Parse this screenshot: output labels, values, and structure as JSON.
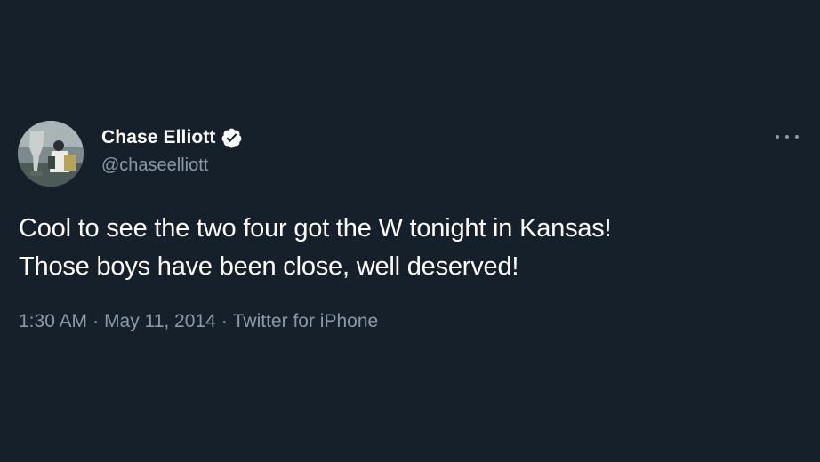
{
  "author": {
    "display_name": "Chase Elliott",
    "handle": "@chaseelliott",
    "verified_icon": "verified-badge-icon",
    "avatar_icon": "trophy-photo-avatar"
  },
  "tweet": {
    "lines": [
      "Cool to see the two four got the W tonight in Kansas!",
      "Those boys have been close, well deserved!"
    ],
    "time": "1:30 AM",
    "separator": "·",
    "date": "May 11, 2014",
    "source": "Twitter for iPhone"
  },
  "menu": {
    "icon": "more-options-icon"
  },
  "colors": {
    "background": "#15202b",
    "primary_text": "#ffffff",
    "secondary_text": "#8b98a5"
  }
}
